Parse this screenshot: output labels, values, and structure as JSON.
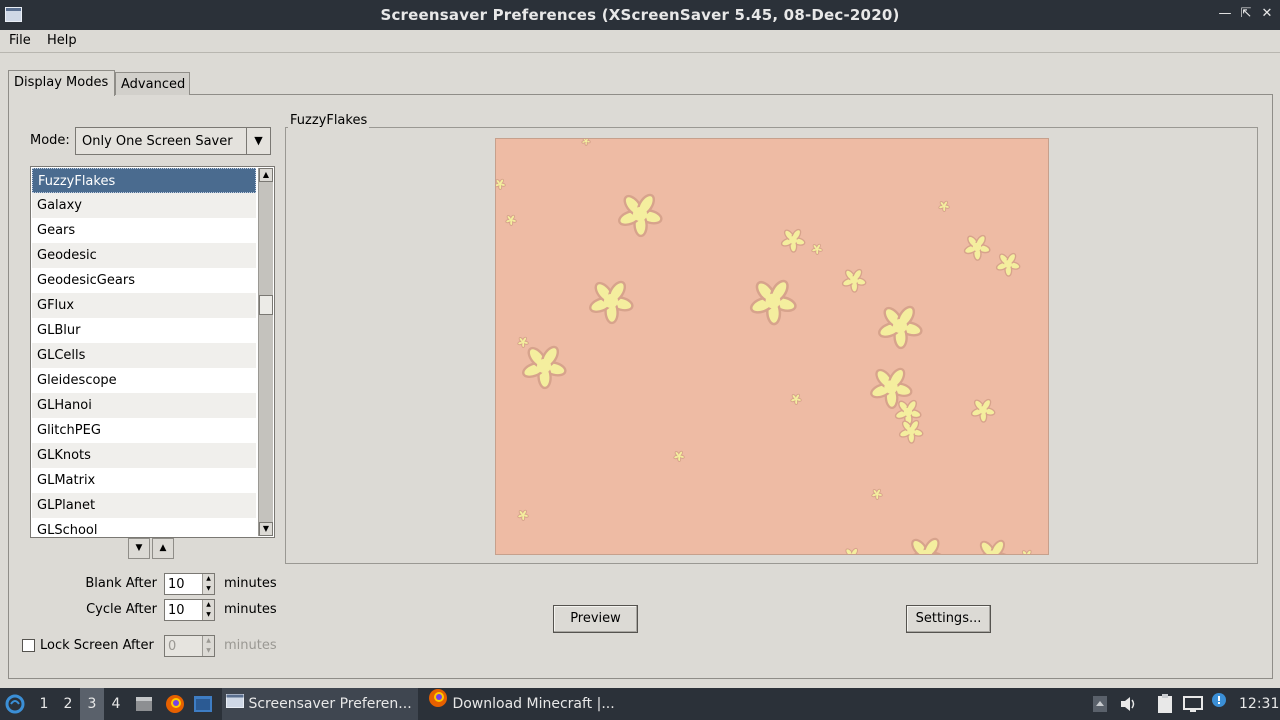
{
  "window": {
    "title": "Screensaver Preferences  (XScreenSaver 5.45, 08-Dec-2020)",
    "controls": [
      "minimize",
      "maximize",
      "close"
    ]
  },
  "menu": {
    "file": "File",
    "help": "Help"
  },
  "tabs": {
    "display_modes": "Display Modes",
    "advanced": "Advanced"
  },
  "mode": {
    "label": "Mode:",
    "value": "Only One Screen Saver"
  },
  "savers": [
    "FuzzyFlakes",
    "Galaxy",
    "Gears",
    "Geodesic",
    "GeodesicGears",
    "GFlux",
    "GLBlur",
    "GLCells",
    "Gleidescope",
    "GLHanoi",
    "GlitchPEG",
    "GLKnots",
    "GLMatrix",
    "GLPlanet",
    "GLSchool"
  ],
  "selected_saver": "FuzzyFlakes",
  "preview": {
    "frame_label": "FuzzyFlakes",
    "background_color": "#eebba4",
    "flake_color": "#f4ee9e"
  },
  "timing": {
    "blank_after": {
      "label": "Blank After",
      "value": "10",
      "unit": "minutes"
    },
    "cycle_after": {
      "label": "Cycle After",
      "value": "10",
      "unit": "minutes"
    },
    "lock_after": {
      "label": "Lock Screen After",
      "value": "0",
      "unit": "minutes",
      "checked": false
    }
  },
  "buttons": {
    "preview": "Preview",
    "settings": "Settings..."
  },
  "taskbar": {
    "workspaces": [
      "1",
      "2",
      "3",
      "4"
    ],
    "current_workspace": "3",
    "tasks": [
      {
        "label": "Screensaver Preferen...",
        "icon": "window-icon"
      },
      {
        "label": "Download Minecraft |...",
        "icon": "firefox-icon"
      }
    ],
    "clock": "12:31"
  }
}
